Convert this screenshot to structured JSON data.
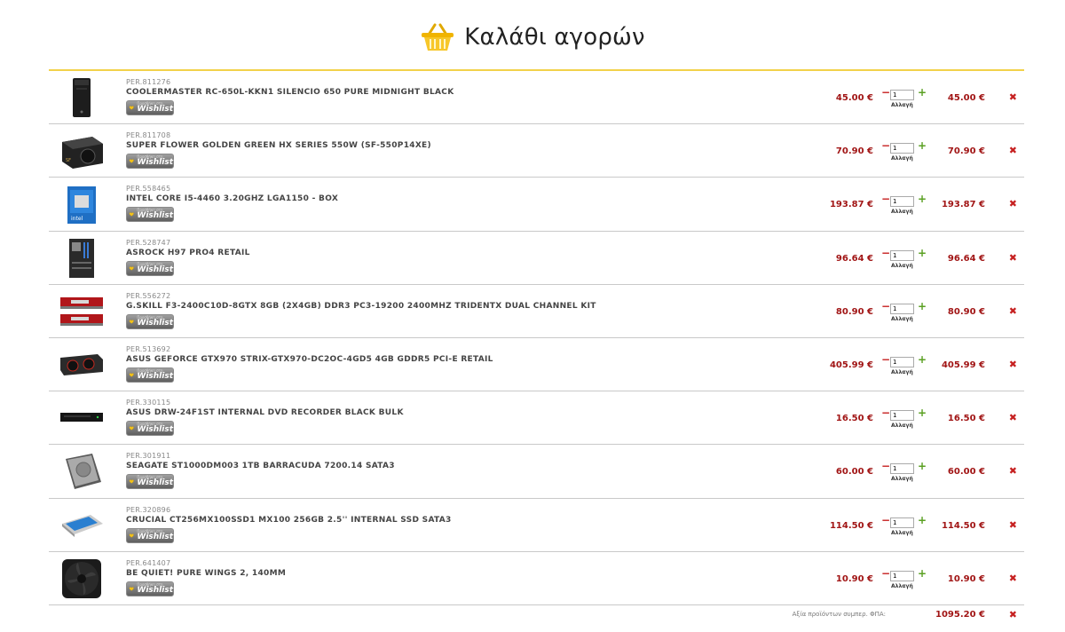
{
  "page": {
    "title": "Καλάθι αγορών"
  },
  "wishlist": {
    "small_text": "Προσθήκη στη",
    "big_text": "Wishlist"
  },
  "qty_update_label": "Αλλαγή",
  "items": [
    {
      "code": "PER.811276",
      "name": "COOLERMASTER RC-650L-KKN1 SILENCIO 650 PURE MIDNIGHT BLACK",
      "price": "45.00 €",
      "qty": "1",
      "total": "45.00 €",
      "icon": "pc-case-icon"
    },
    {
      "code": "PER.811708",
      "name": "SUPER FLOWER GOLDEN GREEN HX SERIES 550W (SF-550P14XE)",
      "price": "70.90 €",
      "qty": "1",
      "total": "70.90 €",
      "icon": "power-supply-icon"
    },
    {
      "code": "PER.558465",
      "name": "INTEL CORE I5-4460 3.20GHZ LGA1150 - BOX",
      "price": "193.87 €",
      "qty": "1",
      "total": "193.87 €",
      "icon": "cpu-box-icon"
    },
    {
      "code": "PER.528747",
      "name": "ASROCK H97 PRO4 RETAIL",
      "price": "96.64 €",
      "qty": "1",
      "total": "96.64 €",
      "icon": "motherboard-icon"
    },
    {
      "code": "PER.556272",
      "name": "G.SKILL F3-2400C10D-8GTX 8GB (2X4GB) DDR3 PC3-19200 2400MHZ TRIDENTX DUAL CHANNEL KIT",
      "price": "80.90 €",
      "qty": "1",
      "total": "80.90 €",
      "icon": "ram-icon"
    },
    {
      "code": "PER.513692",
      "name": "ASUS GEFORCE GTX970 STRIX-GTX970-DC2OC-4GD5 4GB GDDR5 PCI-E RETAIL",
      "price": "405.99 €",
      "qty": "1",
      "total": "405.99 €",
      "icon": "graphics-card-icon"
    },
    {
      "code": "PER.330115",
      "name": "ASUS DRW-24F1ST INTERNAL DVD RECORDER BLACK BULK",
      "price": "16.50 €",
      "qty": "1",
      "total": "16.50 €",
      "icon": "dvd-drive-icon"
    },
    {
      "code": "PER.301911",
      "name": "SEAGATE ST1000DM003 1TB BARRACUDA 7200.14 SATA3",
      "price": "60.00 €",
      "qty": "1",
      "total": "60.00 €",
      "icon": "hard-drive-icon"
    },
    {
      "code": "PER.320896",
      "name": "CRUCIAL CT256MX100SSD1 MX100 256GB 2.5'' INTERNAL SSD SATA3",
      "price": "114.50 €",
      "qty": "1",
      "total": "114.50 €",
      "icon": "ssd-icon"
    },
    {
      "code": "PER.641407",
      "name": "BE QUIET! PURE WINGS 2, 140MM",
      "price": "10.90 €",
      "qty": "1",
      "total": "10.90 €",
      "icon": "case-fan-icon"
    }
  ],
  "footer": {
    "label": "Αξία προϊόντων συμπερ. ΦΠΑ:",
    "value": "1095.20 €"
  },
  "colors": {
    "price": "#a11515",
    "accent_line": "#f2d24a",
    "remove": "#c62020",
    "plus": "#5aa022"
  }
}
